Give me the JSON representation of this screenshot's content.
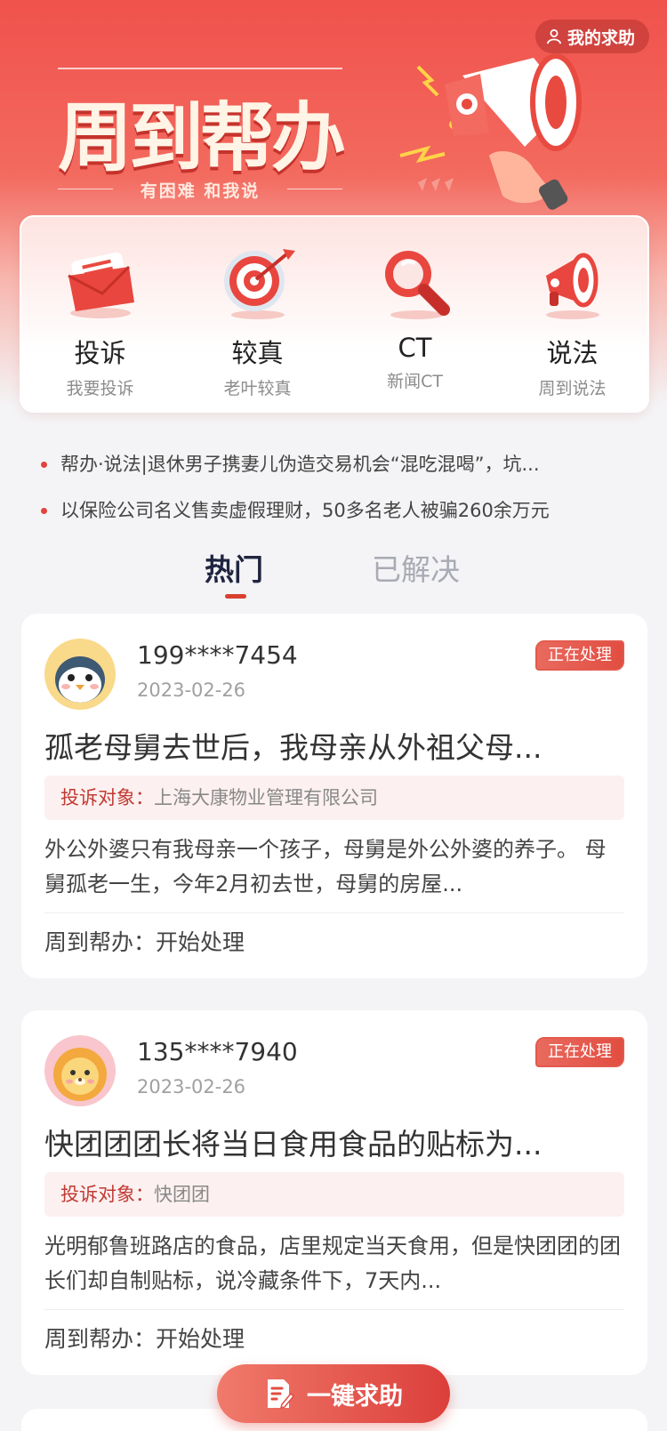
{
  "header": {
    "my_help_label": "我的求助",
    "brand_title": "周到帮办",
    "brand_subtitle": "有困难 和我说"
  },
  "functions": [
    {
      "title": "投诉",
      "subtitle": "我要投诉",
      "icon": "mail-envelope-icon"
    },
    {
      "title": "较真",
      "subtitle": "老叶较真",
      "icon": "target-icon"
    },
    {
      "title": "CT",
      "subtitle": "新闻CT",
      "icon": "magnifier-icon"
    },
    {
      "title": "说法",
      "subtitle": "周到说法",
      "icon": "megaphone-icon"
    }
  ],
  "news": [
    "帮办·说法|退休男子携妻儿伪造交易机会“混吃混喝”，坑...",
    "以保险公司名义售卖虚假理财，50多名老人被骗260余万元"
  ],
  "tabs": {
    "hot": "热门",
    "solved": "已解决"
  },
  "cards": [
    {
      "phone": "199****7454",
      "date": "2023-02-26",
      "status": "正在处理",
      "title": "孤老母舅去世后，我母亲从外祖父母...",
      "target_label": "投诉对象：",
      "target_value": "上海大康物业管理有限公司",
      "desc": "外公外婆只有我母亲一个孩子，母舅是外公外婆的养子。 母舅孤老一生，今年2月初去世，母舅的房屋...",
      "footer": "周到帮办：开始处理",
      "avatar": "penguin-avatar"
    },
    {
      "phone": "135****7940",
      "date": "2023-02-26",
      "status": "正在处理",
      "title": "快团团团长将当日食用食品的贴标为...",
      "target_label": "投诉对象：",
      "target_value": "快团团",
      "desc": "光明郁鲁班路店的食品，店里规定当天食用，但是快团团的团长们却自制贴标，说冷藏条件下，7天内...",
      "footer": "周到帮办：开始处理",
      "avatar": "lion-avatar"
    }
  ],
  "cta_label": "一键求助",
  "colors": {
    "accent": "#e0443d",
    "hero_top": "#f0524c",
    "background": "#f4f4f6"
  }
}
